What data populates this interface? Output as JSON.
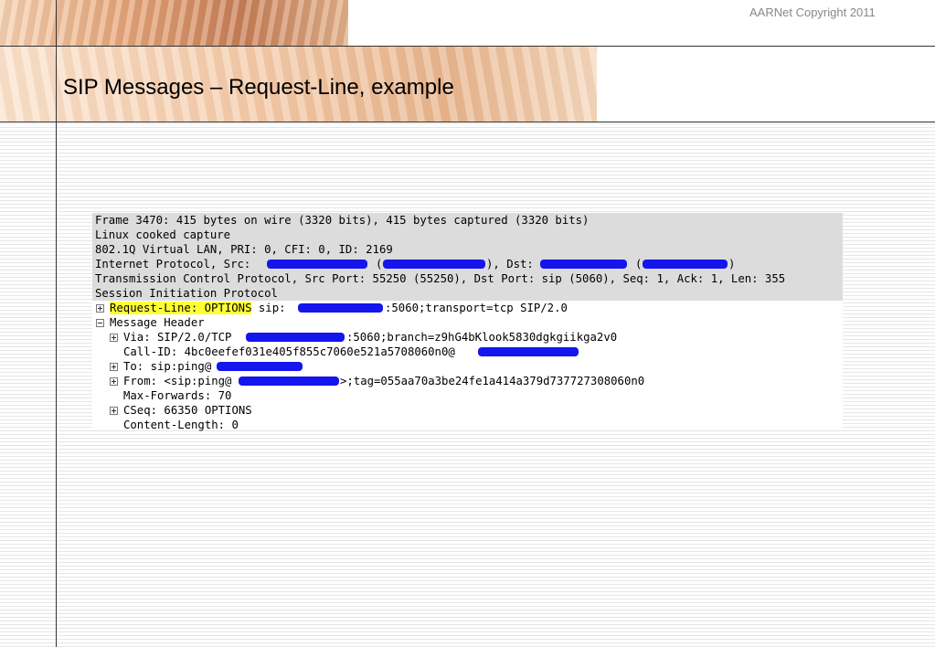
{
  "header": {
    "copyright": "AARNet Copyright 2011",
    "title": "SIP Messages – Request-Line, example"
  },
  "capture": {
    "frame": "Frame 3470: 415 bytes on wire (3320 bits), 415 bytes captured (3320 bits)",
    "linux": "Linux cooked capture",
    "vlan": "802.1Q Virtual LAN, PRI: 0, CFI: 0, ID: 2169",
    "ip_prefix": "Internet Protocol, Src: ",
    "ip_open1": "(",
    "ip_mid": "), Dst: ",
    "ip_open2": "(",
    "ip_close": ")",
    "tcp": "Transmission Control Protocol, Src Port: 55250 (55250), Dst Port: sip (5060), Seq: 1, Ack: 1, Len: 355",
    "sip": "Session Initiation Protocol",
    "request_line_label": "Request-Line: OPTIONS",
    "request_line_rest_a": " sip:",
    "request_line_rest_b": ":5060;transport=tcp SIP/2.0",
    "message_header": "Message Header",
    "via_a": "Via: SIP/2.0/TCP ",
    "via_b": ":5060;branch=z9hG4bKlook5830dgkgiikga2v0",
    "callid": "Call-ID: 4bc0eefef031e405f855c7060e521a5708060n0@",
    "to": "To: sip:ping@",
    "from_a": "From: <sip:ping@",
    "from_b": ">;tag=055aa70a3be24fe1a414a379d737727308060n0",
    "maxfwd": "Max-Forwards: 70",
    "cseq": "CSeq: 66350 OPTIONS",
    "contentlen": "Content-Length: 0"
  },
  "colors": {
    "highlight": "#ffff33",
    "redaction": "#1515ee",
    "row_shade": "#dcdcdc"
  }
}
